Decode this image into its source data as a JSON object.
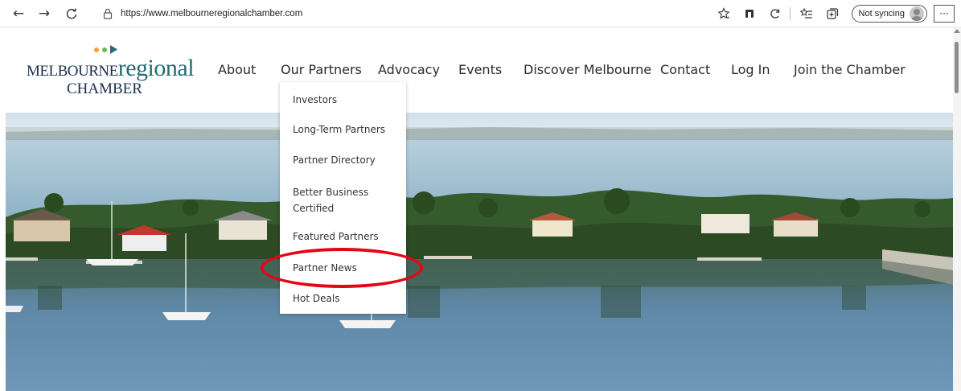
{
  "browser": {
    "url": "https://www.melbourneregionalchamber.com",
    "sync_label": "Not syncing",
    "more_label": "···",
    "back_glyph": "←",
    "forward_glyph": "→",
    "refresh_glyph": "C"
  },
  "logo": {
    "word1": "MELBOURNE",
    "word2": "regional",
    "sub": "CHAMBER",
    "dot_colors": [
      "#f2a23a",
      "#6fb64a",
      "#1f6e73"
    ]
  },
  "nav": {
    "items": [
      "About",
      "Our Partners",
      "Advocacy",
      "Events",
      "Discover Melbourne",
      "Contact",
      "Log In",
      "Join the Chamber"
    ],
    "active_index": 1,
    "accent": "#1f6e73"
  },
  "dropdown": {
    "items": [
      "Investors",
      "Long-Term Partners",
      "Partner Directory",
      "Better Business Certified",
      "Featured Partners",
      "Partner News",
      "Hot Deals"
    ],
    "highlighted": "Partner News",
    "highlight_color": "#e30613"
  }
}
